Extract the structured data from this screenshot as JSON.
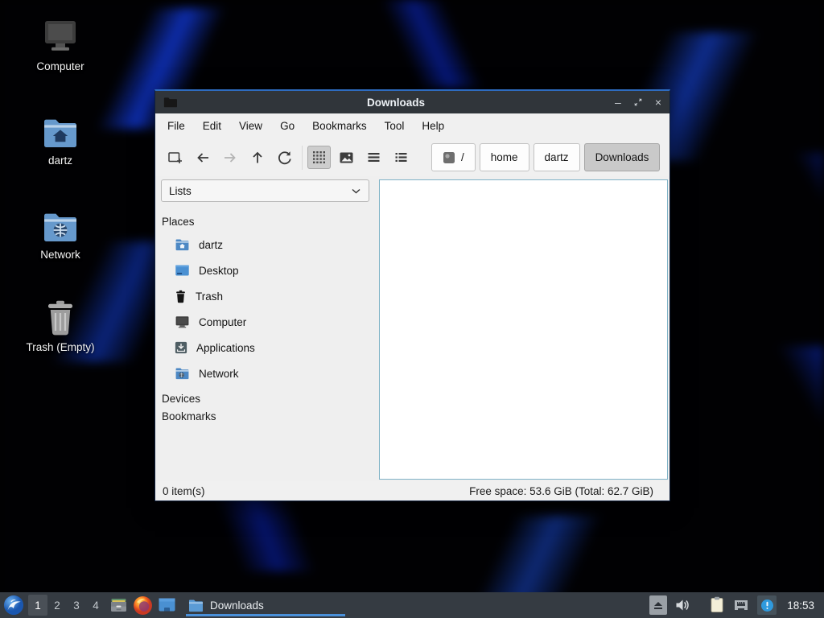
{
  "colors": {
    "accent_blue": "#4a90d9",
    "titlebar_bg": "#30353a",
    "taskbar_bg": "#353b42",
    "toolbar_bg": "#f0f0f0",
    "file_pane_border": "#7fb2c6",
    "folder_blue": "#5b9bd5",
    "wallpaper_streak_blue": "#123ce6",
    "pressed_button_bg": "#cdcdcd"
  },
  "desktop": {
    "icons": [
      {
        "label": "Computer",
        "icon": "computer-icon"
      },
      {
        "label": "dartz",
        "icon": "folder-home-icon"
      },
      {
        "label": "Network",
        "icon": "folder-network-icon"
      },
      {
        "label": "Trash (Empty)",
        "icon": "trash-icon"
      }
    ]
  },
  "window": {
    "title": "Downloads",
    "controls": {
      "minimize": "–",
      "close": "×"
    },
    "menubar": [
      "File",
      "Edit",
      "View",
      "Go",
      "Bookmarks",
      "Tool",
      "Help"
    ],
    "toolbar": {
      "buttons": [
        "new-tab",
        "back",
        "forward",
        "up",
        "refresh",
        "icon-view",
        "thumbnail-view",
        "compact-view",
        "detailed-list-view"
      ],
      "pathbar": [
        {
          "label": "/",
          "icon": "disk-icon",
          "active": false
        },
        {
          "label": "home",
          "active": false
        },
        {
          "label": "dartz",
          "active": false
        },
        {
          "label": "Downloads",
          "active": true
        }
      ]
    },
    "sidebar": {
      "view_selector": "Lists",
      "places_header": "Places",
      "places": [
        {
          "label": "dartz",
          "icon": "folder-home-icon"
        },
        {
          "label": "Desktop",
          "icon": "desktop-icon"
        },
        {
          "label": "Trash",
          "icon": "trash-icon"
        },
        {
          "label": "Computer",
          "icon": "computer-icon"
        },
        {
          "label": "Applications",
          "icon": "applications-icon"
        },
        {
          "label": "Network",
          "icon": "folder-network-icon"
        }
      ],
      "devices_header": "Devices",
      "bookmarks_header": "Bookmarks"
    },
    "statusbar": {
      "items_count": "0 item(s)",
      "free_space": "Free space: 53.6 GiB (Total: 62.7 GiB)"
    }
  },
  "taskbar": {
    "workspaces": [
      "1",
      "2",
      "3",
      "4"
    ],
    "active_workspace": "1",
    "launchers": [
      "file-manager",
      "firefox",
      "desktop-viewer"
    ],
    "task": {
      "label": "Downloads",
      "icon": "folder-icon"
    },
    "tray": [
      "removable-media",
      "volume",
      "clipboard",
      "network",
      "notification"
    ],
    "clock": "18:53"
  }
}
